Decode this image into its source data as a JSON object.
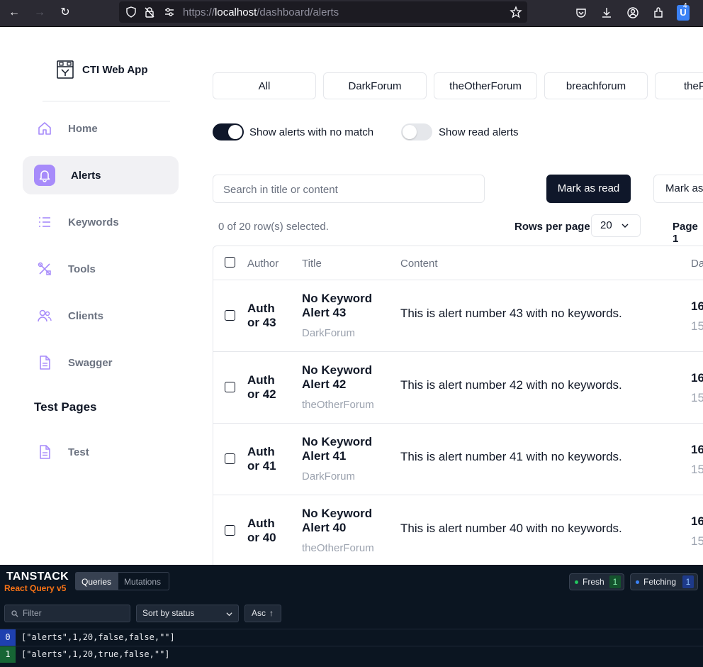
{
  "browser": {
    "url_scheme": "https://",
    "url_host": "localhost",
    "url_path": "/dashboard/alerts",
    "extension_badge": "4"
  },
  "sidebar": {
    "app_title": "CTI Web App",
    "items": [
      {
        "label": "Home",
        "icon": "home-icon"
      },
      {
        "label": "Alerts",
        "icon": "bell-icon",
        "active": true
      },
      {
        "label": "Keywords",
        "icon": "list-icon"
      },
      {
        "label": "Tools",
        "icon": "tools-icon"
      },
      {
        "label": "Clients",
        "icon": "users-icon"
      },
      {
        "label": "Swagger",
        "icon": "document-icon"
      }
    ],
    "section_title": "Test Pages",
    "test_items": [
      {
        "label": "Test",
        "icon": "document-icon"
      }
    ]
  },
  "filters": {
    "tabs": [
      "All",
      "DarkForum",
      "theOtherForum",
      "breachforum",
      "theF"
    ],
    "show_no_match_label": "Show alerts with no match",
    "show_no_match": true,
    "show_read_label": "Show read alerts",
    "show_read": false
  },
  "toolbar": {
    "search_placeholder": "Search in title or content",
    "mark_read_label": "Mark as read",
    "mark_as_label": "Mark as"
  },
  "pagination": {
    "selected_text": "0 of 20 row(s) selected.",
    "rows_per_page_label": "Rows per page",
    "rows_per_page_value": "20",
    "page_label": "Page 1"
  },
  "table": {
    "headers": [
      "Author",
      "Title",
      "Content",
      "Da"
    ],
    "rows": [
      {
        "author_line1": "Auth",
        "author_line2": "or 43",
        "title_line1": "No Keyword",
        "title_line2": "Alert 43",
        "forum": "DarkForum",
        "content": "This is alert number 43 with no keywords.",
        "date": "16",
        "sub": "15"
      },
      {
        "author_line1": "Auth",
        "author_line2": "or 42",
        "title_line1": "No Keyword",
        "title_line2": "Alert 42",
        "forum": "theOtherForum",
        "content": "This is alert number 42 with no keywords.",
        "date": "16",
        "sub": "15"
      },
      {
        "author_line1": "Auth",
        "author_line2": "or 41",
        "title_line1": "No Keyword",
        "title_line2": "Alert 41",
        "forum": "DarkForum",
        "content": "This is alert number 41 with no keywords.",
        "date": "16",
        "sub": "15"
      },
      {
        "author_line1": "Auth",
        "author_line2": "or 40",
        "title_line1": "No Keyword",
        "title_line2": "Alert 40",
        "forum": "theOtherForum",
        "content": "This is alert number 40 with no keywords.",
        "date": "16",
        "sub": "15"
      }
    ]
  },
  "devtools": {
    "logo_top": "TANSTACK",
    "logo_bottom": "React Query v5",
    "tab_queries": "Queries",
    "tab_mutations": "Mutations",
    "fresh_label": "Fresh",
    "fresh_count": "1",
    "fetching_label": "Fetching",
    "fetching_count": "1",
    "filter_placeholder": "Filter",
    "sort_label": "Sort by status",
    "order_label": "Asc",
    "queries": [
      {
        "index": "0",
        "key": "[\"alerts\",1,20,false,false,\"\"]",
        "status_color": "#1e40af"
      },
      {
        "index": "1",
        "key": "[\"alerts\",1,20,true,false,\"\"]",
        "status_color": "#166534"
      }
    ]
  },
  "colors": {
    "accent": "#a78bfa",
    "primary_button": "#0f172a",
    "toggle_on": "#0f172a",
    "toggle_off": "#e5e7eb"
  }
}
